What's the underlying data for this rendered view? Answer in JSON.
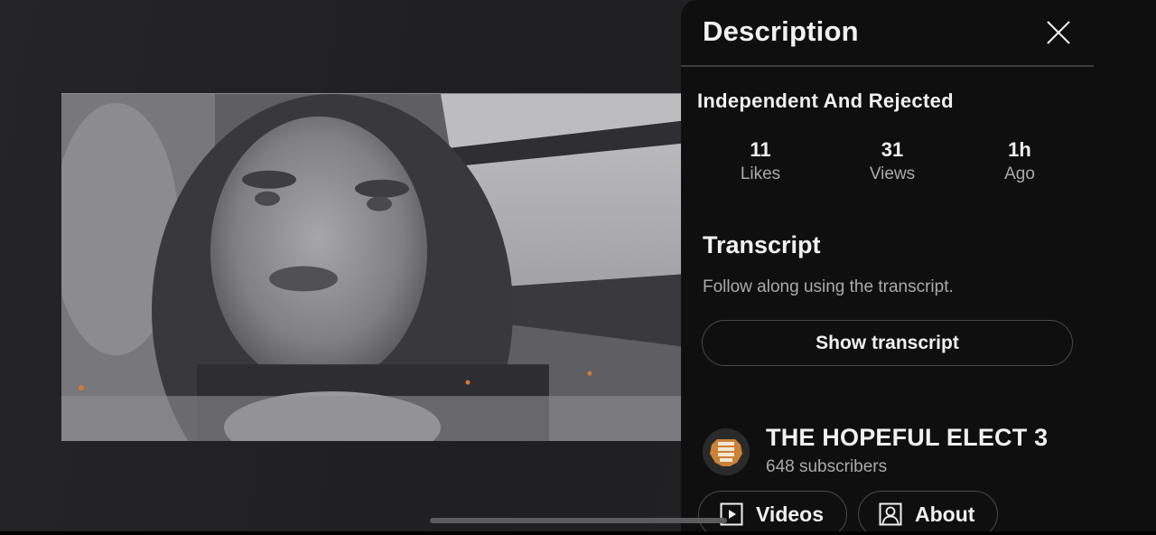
{
  "panel": {
    "title": "Description",
    "close_icon": "close-icon"
  },
  "video": {
    "title": "Independent And Rejected",
    "thumbnail_description": "Black-and-white selfie video of a woman in a car"
  },
  "stats": [
    {
      "value": "11",
      "label": "Likes"
    },
    {
      "value": "31",
      "label": "Views"
    },
    {
      "value": "1h",
      "label": "Ago"
    }
  ],
  "transcript": {
    "heading": "Transcript",
    "subtitle": "Follow along using the transcript.",
    "button_label": "Show transcript"
  },
  "channel": {
    "name": "THE HOPEFUL ELECT 3",
    "subscribers": "648 subscribers",
    "avatar_icon": "channel-avatar"
  },
  "channel_buttons": [
    {
      "label": "Videos",
      "icon": "play-square-icon"
    },
    {
      "label": "About",
      "icon": "person-square-icon"
    }
  ],
  "colors": {
    "panel_bg": "#0f0f0f",
    "stage_bg": "#232325",
    "text_primary": "#f1f1f1",
    "text_secondary": "#aaaaaa",
    "border": "#4a4a4a"
  }
}
